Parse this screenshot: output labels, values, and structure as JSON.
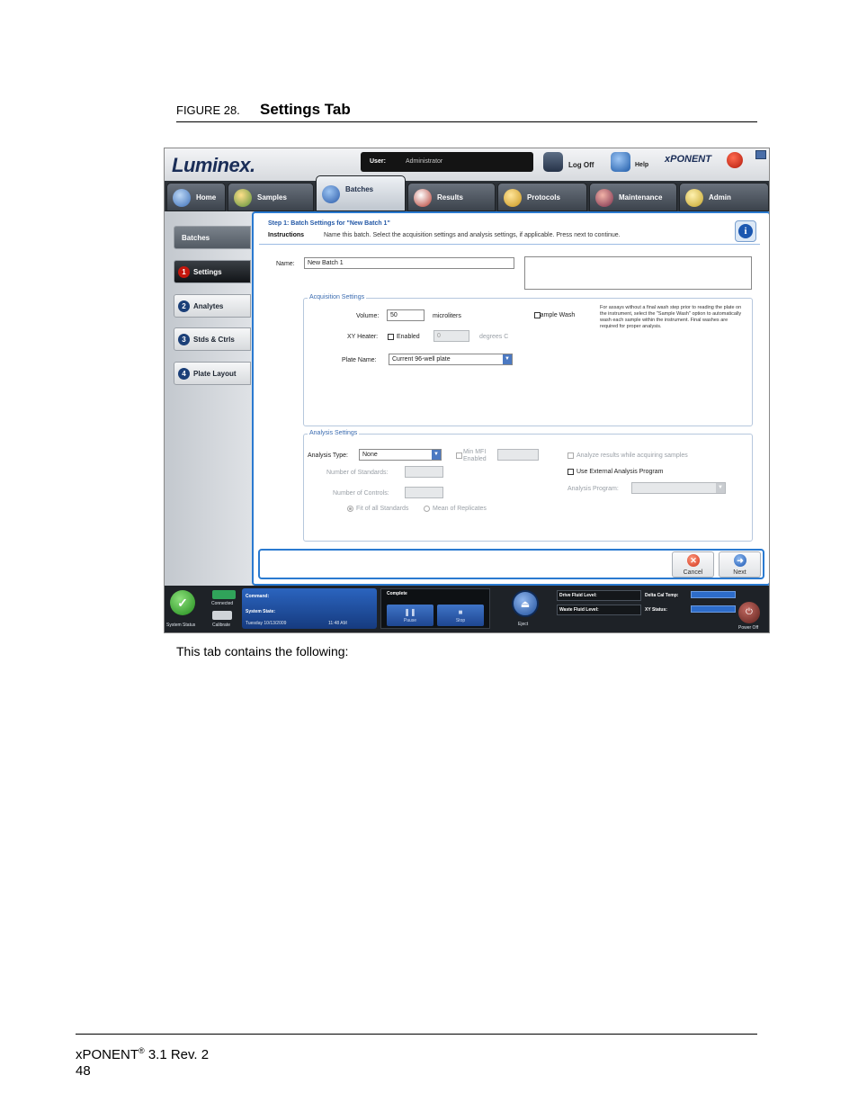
{
  "figure": {
    "number": "FIGURE 28.",
    "title": "Settings Tab"
  },
  "body_text": "This tab contains the following:",
  "footer": {
    "product": "xPONENT",
    "registered": "®",
    "version": " 3.1 Rev. 2",
    "page": "48"
  },
  "app": {
    "logo": "Luminex.",
    "user": {
      "label": "User:",
      "value": "Administrator"
    },
    "logoff_label": "Log Off",
    "help_label": "Help",
    "brand": "xPONENT",
    "nav_tabs": [
      {
        "label": "Home",
        "active": false
      },
      {
        "label": "Samples",
        "active": false
      },
      {
        "label": "Batches",
        "active": true
      },
      {
        "label": "Results",
        "active": false
      },
      {
        "label": "Protocols",
        "active": false
      },
      {
        "label": "Maintenance",
        "active": false
      },
      {
        "label": "Admin",
        "active": false
      }
    ],
    "side_nav": [
      {
        "num": "",
        "label": "Batches"
      },
      {
        "num": "1",
        "label": "Settings"
      },
      {
        "num": "2",
        "label": "Analytes"
      },
      {
        "num": "3",
        "label": "Stds & Ctrls"
      },
      {
        "num": "4",
        "label": "Plate Layout"
      }
    ],
    "step_title": "Step 1: Batch Settings for \"New Batch 1\"",
    "instructions_label": "Instructions",
    "instructions_text": "Name this batch. Select the acquisition settings and analysis settings, if applicable. Press next to continue.",
    "info_icon": "i",
    "name": {
      "label": "Name:",
      "value": "New Batch 1"
    },
    "acquisition": {
      "title": "Acquisition Settings",
      "volume_label": "Volume:",
      "volume_value": "50",
      "volume_unit": "microliters",
      "xy_heater_label": "XY Heater:",
      "xy_heater_enabled_label": "Enabled",
      "xy_heater_value": "0",
      "xy_heater_unit": "degrees C",
      "plate_name_label": "Plate Name:",
      "plate_name_value": "Current 96-well plate",
      "sample_wash_label": "Sample Wash",
      "sample_wash_help": "For assays without a final wash step prior to reading the plate on the instrument, select the \"Sample Wash\" option to automatically wash each sample within the instrument.  Final washes are required for proper analysis."
    },
    "analysis": {
      "title": "Analysis Settings",
      "type_label": "Analysis Type:",
      "type_value": "None",
      "min_mfi_label": "Min MFI",
      "min_mfi_enabled_label": "Enabled",
      "num_standards_label": "Number of Standards:",
      "num_controls_label": "Number of Controls:",
      "fit_all_label": "Fit of all Standards",
      "mean_replicates_label": "Mean of Replicates",
      "analyze_while_label": "Analyze results while acquiring samples",
      "use_external_label": "Use External Analysis Program",
      "analysis_program_label": "Analysis Program:"
    },
    "buttons": {
      "cancel": "Cancel",
      "next": "Next"
    },
    "status": {
      "system_status": "System Status",
      "connected": "Connected",
      "calibrate": "Calibrate",
      "command_label": "Command:",
      "system_state_label": "System State:",
      "date": "Tuesday 10/13/2009",
      "time": "11:48 AM",
      "progress_label": "Complete",
      "pause": "Pause",
      "stop": "Stop",
      "eject": "Eject",
      "drive_fluid": "Drive Fluid Level:",
      "waste_fluid": "Waste Fluid Level:",
      "delta_cal_temp": "Delta Cal Temp:",
      "xy_status": "XY Status:",
      "power_off": "Power Off"
    }
  }
}
